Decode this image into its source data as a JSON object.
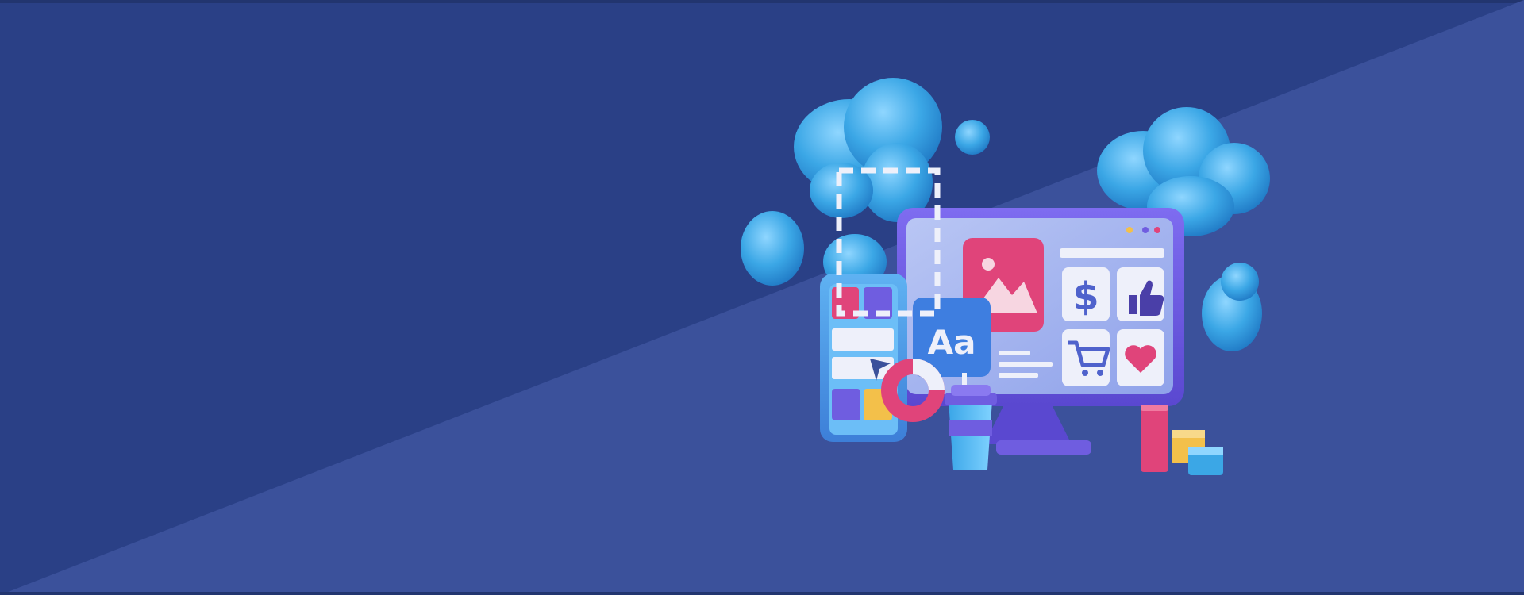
{
  "banner": {
    "background_colors": {
      "dark": "#2a4086",
      "light": "#3b519b",
      "top_edge": "#22356f"
    }
  },
  "illustration": {
    "font_sample_text": "Aa",
    "icon_names": [
      "cloud-icon",
      "bubble-icon",
      "image-icon",
      "dollar-icon",
      "thumbs-up-icon",
      "cart-icon",
      "heart-icon",
      "coffee-cup-icon",
      "donut-chart-icon",
      "cursor-icon",
      "bar-block-icon",
      "cube-icon"
    ],
    "accent_colors": {
      "cloud_blue": "#3ba7e6",
      "monitor_purple": "#6f5de0",
      "pink": "#e0447a",
      "yellow": "#f3c04a",
      "card_white": "#eef0fa"
    }
  }
}
